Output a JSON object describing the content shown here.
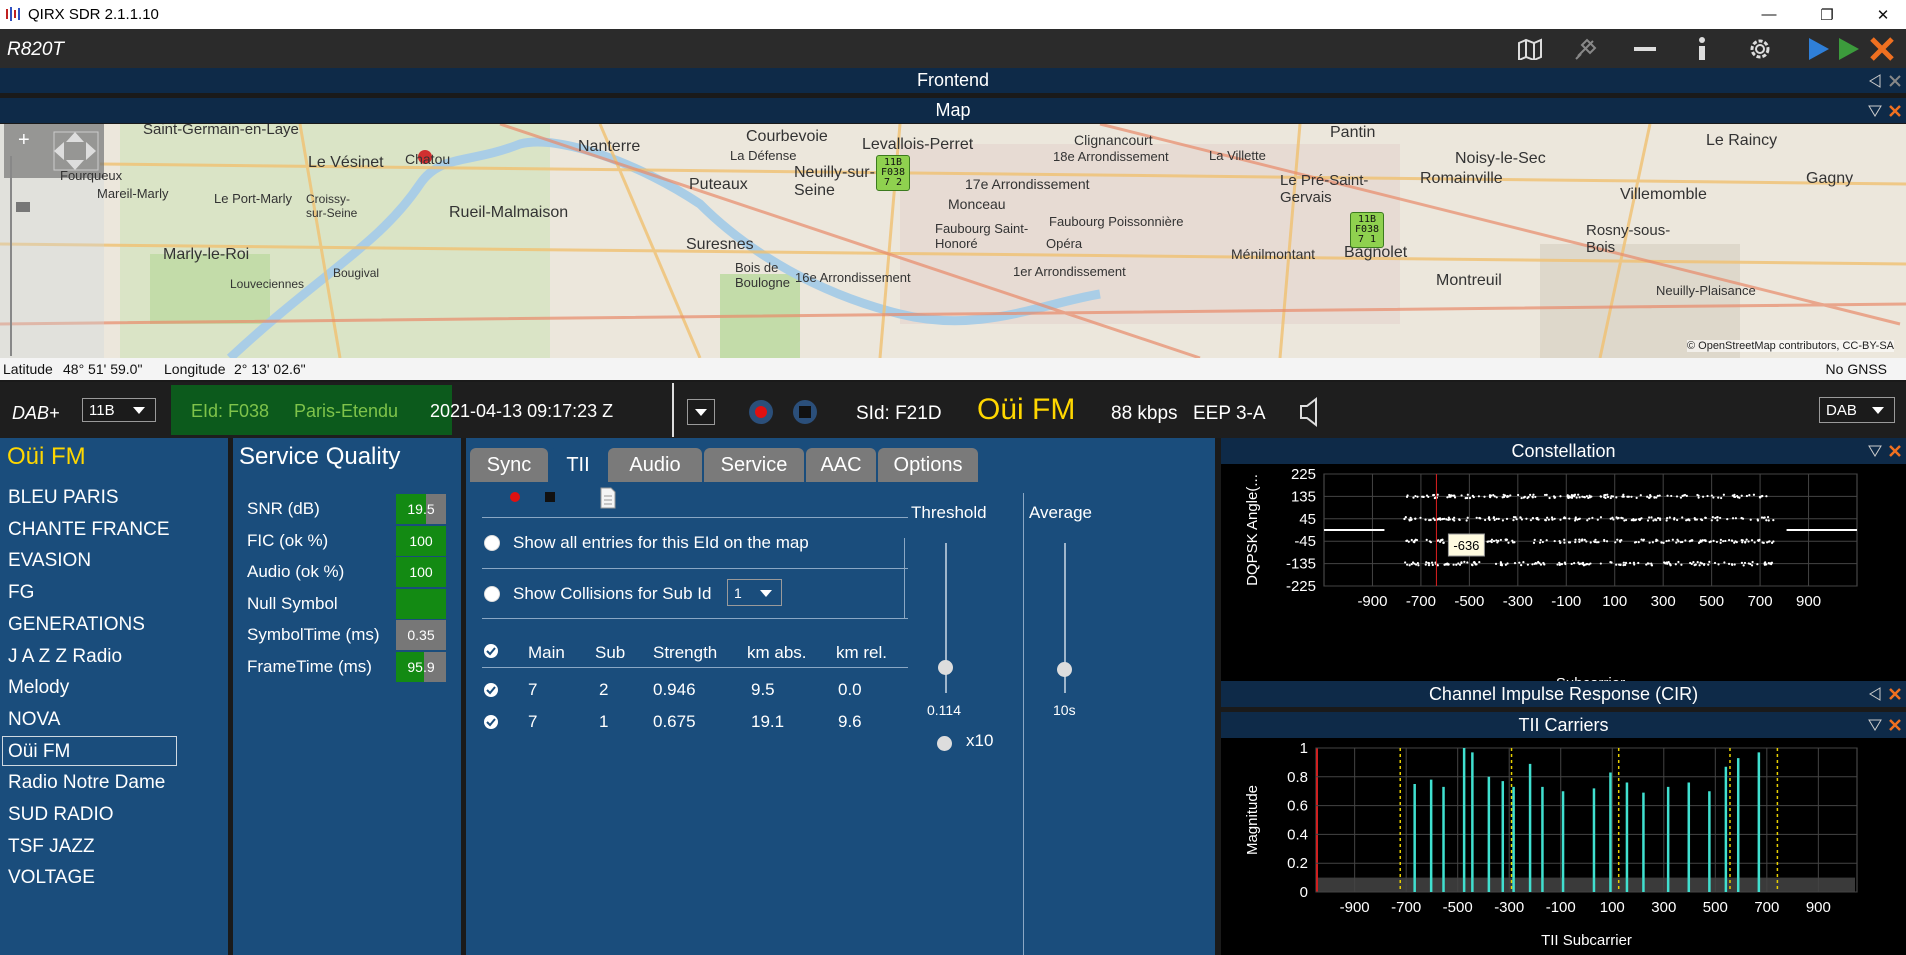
{
  "window": {
    "title": "QIRX SDR 2.1.1.10",
    "controls": [
      "—",
      "❐",
      "✕"
    ]
  },
  "toolbar": {
    "device": "R820T"
  },
  "frontend_panel": {
    "title": "Frontend"
  },
  "map_panel": {
    "title": "Map",
    "place_labels": [
      "Saint-Germain-en-Laye",
      "Le Vésinet",
      "Chatou",
      "Nanterre",
      "Courbevoie",
      "Levallois-Perret",
      "Clignancourt",
      "Pantin",
      "Le Raincy",
      "Fourqueux",
      "Mareil-Marly",
      "Le Port-Marly",
      "Croissy-sur-Seine",
      "Rueil-Malmaison",
      "Puteaux",
      "La Défense",
      "Neuilly-sur-Seine",
      "18e Arrondissement",
      "La Villette",
      "Noisy-le-Sec",
      "17e Arrondissement",
      "Le Pré-Saint-Gervais",
      "Romainville",
      "Villemomble",
      "Gagny",
      "Suresnes",
      "Monceau",
      "Faubourg Poissonnière",
      "Faubourg Saint-Honoré",
      "Opéra",
      "Rosny-sous-Bois",
      "Marly-le-Roi",
      "Bougival",
      "Louveciennes",
      "Bois de Boulogne",
      "16e Arrondissement",
      "1er Arrondissement",
      "Ménilmontant",
      "Bagnolet",
      "Montreuil",
      "Neuilly-Plaisance"
    ],
    "markers": [
      {
        "line1": "11B",
        "line2": "F038",
        "line3": "7 2"
      },
      {
        "line1": "11B",
        "line2": "F038",
        "line3": "7 1"
      }
    ],
    "attribution": "© OpenStreetMap contributors, CC-BY-SA",
    "latitude_label": "Latitude",
    "latitude": "48° 51' 59.0\"",
    "longitude_label": "Longitude",
    "longitude": "2° 13' 02.6\"",
    "gnss_status": "No GNSS"
  },
  "dab_bar": {
    "mode": "DAB+",
    "channel": "11B",
    "eid": "EId: F038",
    "ensemble": "Paris-Etendu",
    "datetime": "2021-04-13  09:17:23 Z",
    "sid": "SId: F21D",
    "station": "Oüi FM",
    "bitrate": "88 kbps",
    "protection": "EEP 3-A",
    "band": "DAB"
  },
  "services": {
    "current": "Oüi FM",
    "items": [
      "BLEU PARIS",
      "CHANTE FRANCE",
      "EVASION",
      "FG",
      "GENERATIONS",
      "J A Z Z Radio",
      "Melody",
      "NOVA",
      "Oüi FM",
      "Radio Notre Dame",
      "SUD RADIO",
      "TSF JAZZ",
      "VOLTAGE"
    ],
    "selected_index": 8
  },
  "service_quality": {
    "title": "Service Quality",
    "rows": [
      {
        "label": "SNR (dB)",
        "value": "19.5",
        "fill": 0.6
      },
      {
        "label": "FIC (ok %)",
        "value": "100",
        "fill": 1.0
      },
      {
        "label": "Audio (ok %)",
        "value": "100",
        "fill": 1.0
      },
      {
        "label": "Null Symbol",
        "value": "",
        "fill": 1.0
      },
      {
        "label": "SymbolTime (ms)",
        "value": "0.35",
        "fill": 0.0
      },
      {
        "label": "FrameTime (ms)",
        "value": "95.9",
        "fill": 0.55
      }
    ]
  },
  "tii_panel": {
    "tabs": [
      "Sync",
      "TII",
      "Audio",
      "Service",
      "AAC",
      "Options"
    ],
    "active_tab": 1,
    "show_all_label": "Show all entries for this EId on the map",
    "show_collisions_label": "Show Collisions for Sub Id",
    "collision_sub_id": "1",
    "threshold_label": "Threshold",
    "threshold_value": "0.114",
    "average_label": "Average",
    "average_value": "10s",
    "x10_label": "x10",
    "table": {
      "columns": [
        "Main",
        "Sub",
        "Strength",
        "km abs.",
        "km rel."
      ],
      "rows": [
        [
          "7",
          "2",
          "0.946",
          "9.5",
          "0.0"
        ],
        [
          "7",
          "1",
          "0.675",
          "19.1",
          "9.6"
        ]
      ]
    }
  },
  "constellation": {
    "title": "Constellation",
    "ylabel": "DQPSK  Angle(...",
    "xlabel": "Subcarrier",
    "cursor_label": "-636"
  },
  "cir_panel": {
    "title": "Channel Impulse Response (CIR)"
  },
  "tii_carriers": {
    "title": "TII Carriers",
    "ylabel": "Magnitude",
    "xlabel": "TII Subcarrier"
  },
  "chart_data": [
    {
      "type": "scatter",
      "title": "Constellation",
      "xlabel": "Subcarrier",
      "ylabel": "DQPSK  Angle(...",
      "xlim": [
        -1100,
        1100
      ],
      "ylim": [
        -225,
        225
      ],
      "xticks": [
        -900,
        -700,
        -500,
        -300,
        -100,
        100,
        300,
        500,
        700,
        900
      ],
      "yticks": [
        225,
        135,
        45,
        -45,
        -135,
        -225
      ],
      "series": [
        {
          "values_y": [
            135,
            45,
            -45,
            -135
          ],
          "x_range": [
            -768,
            768
          ]
        }
      ],
      "cursor_x": -636
    },
    {
      "type": "bar",
      "title": "TII Carriers",
      "xlabel": "TII Subcarrier",
      "ylabel": "Magnitude",
      "xlim": [
        -1050,
        1050
      ],
      "ylim": [
        0.0,
        1.0
      ],
      "xticks": [
        -900,
        -700,
        -500,
        -300,
        -100,
        100,
        300,
        500,
        700,
        900
      ],
      "yticks": [
        1.0,
        0.8,
        0.6,
        0.4,
        0.2,
        0.0
      ],
      "bars": [
        {
          "x": -667,
          "value": 0.75
        },
        {
          "x": -603,
          "value": 0.78
        },
        {
          "x": -555,
          "value": 0.73
        },
        {
          "x": -475,
          "value": 1.0
        },
        {
          "x": -443,
          "value": 0.97
        },
        {
          "x": -379,
          "value": 0.8
        },
        {
          "x": -325,
          "value": 0.77
        },
        {
          "x": -283,
          "value": 0.73
        },
        {
          "x": -219,
          "value": 0.89
        },
        {
          "x": -171,
          "value": 0.73
        },
        {
          "x": -91,
          "value": 0.7
        },
        {
          "x": 29,
          "value": 0.72
        },
        {
          "x": 93,
          "value": 0.83
        },
        {
          "x": 157,
          "value": 0.76
        },
        {
          "x": 221,
          "value": 0.69
        },
        {
          "x": 317,
          "value": 0.73
        },
        {
          "x": 397,
          "value": 0.76
        },
        {
          "x": 477,
          "value": 0.7
        },
        {
          "x": 541,
          "value": 0.87
        },
        {
          "x": 589,
          "value": 0.93
        },
        {
          "x": 669,
          "value": 0.97
        }
      ],
      "dashed_lines_x": [
        -723,
        -291,
        125,
        557,
        741
      ]
    }
  ],
  "colors": {
    "panel_blue": "#1a4d7c",
    "header_navy": "#0e2a48",
    "station_yellow": "#ffd700",
    "ensemble_green": "#7fc34a",
    "bar_cyan": "#40e0d0"
  }
}
